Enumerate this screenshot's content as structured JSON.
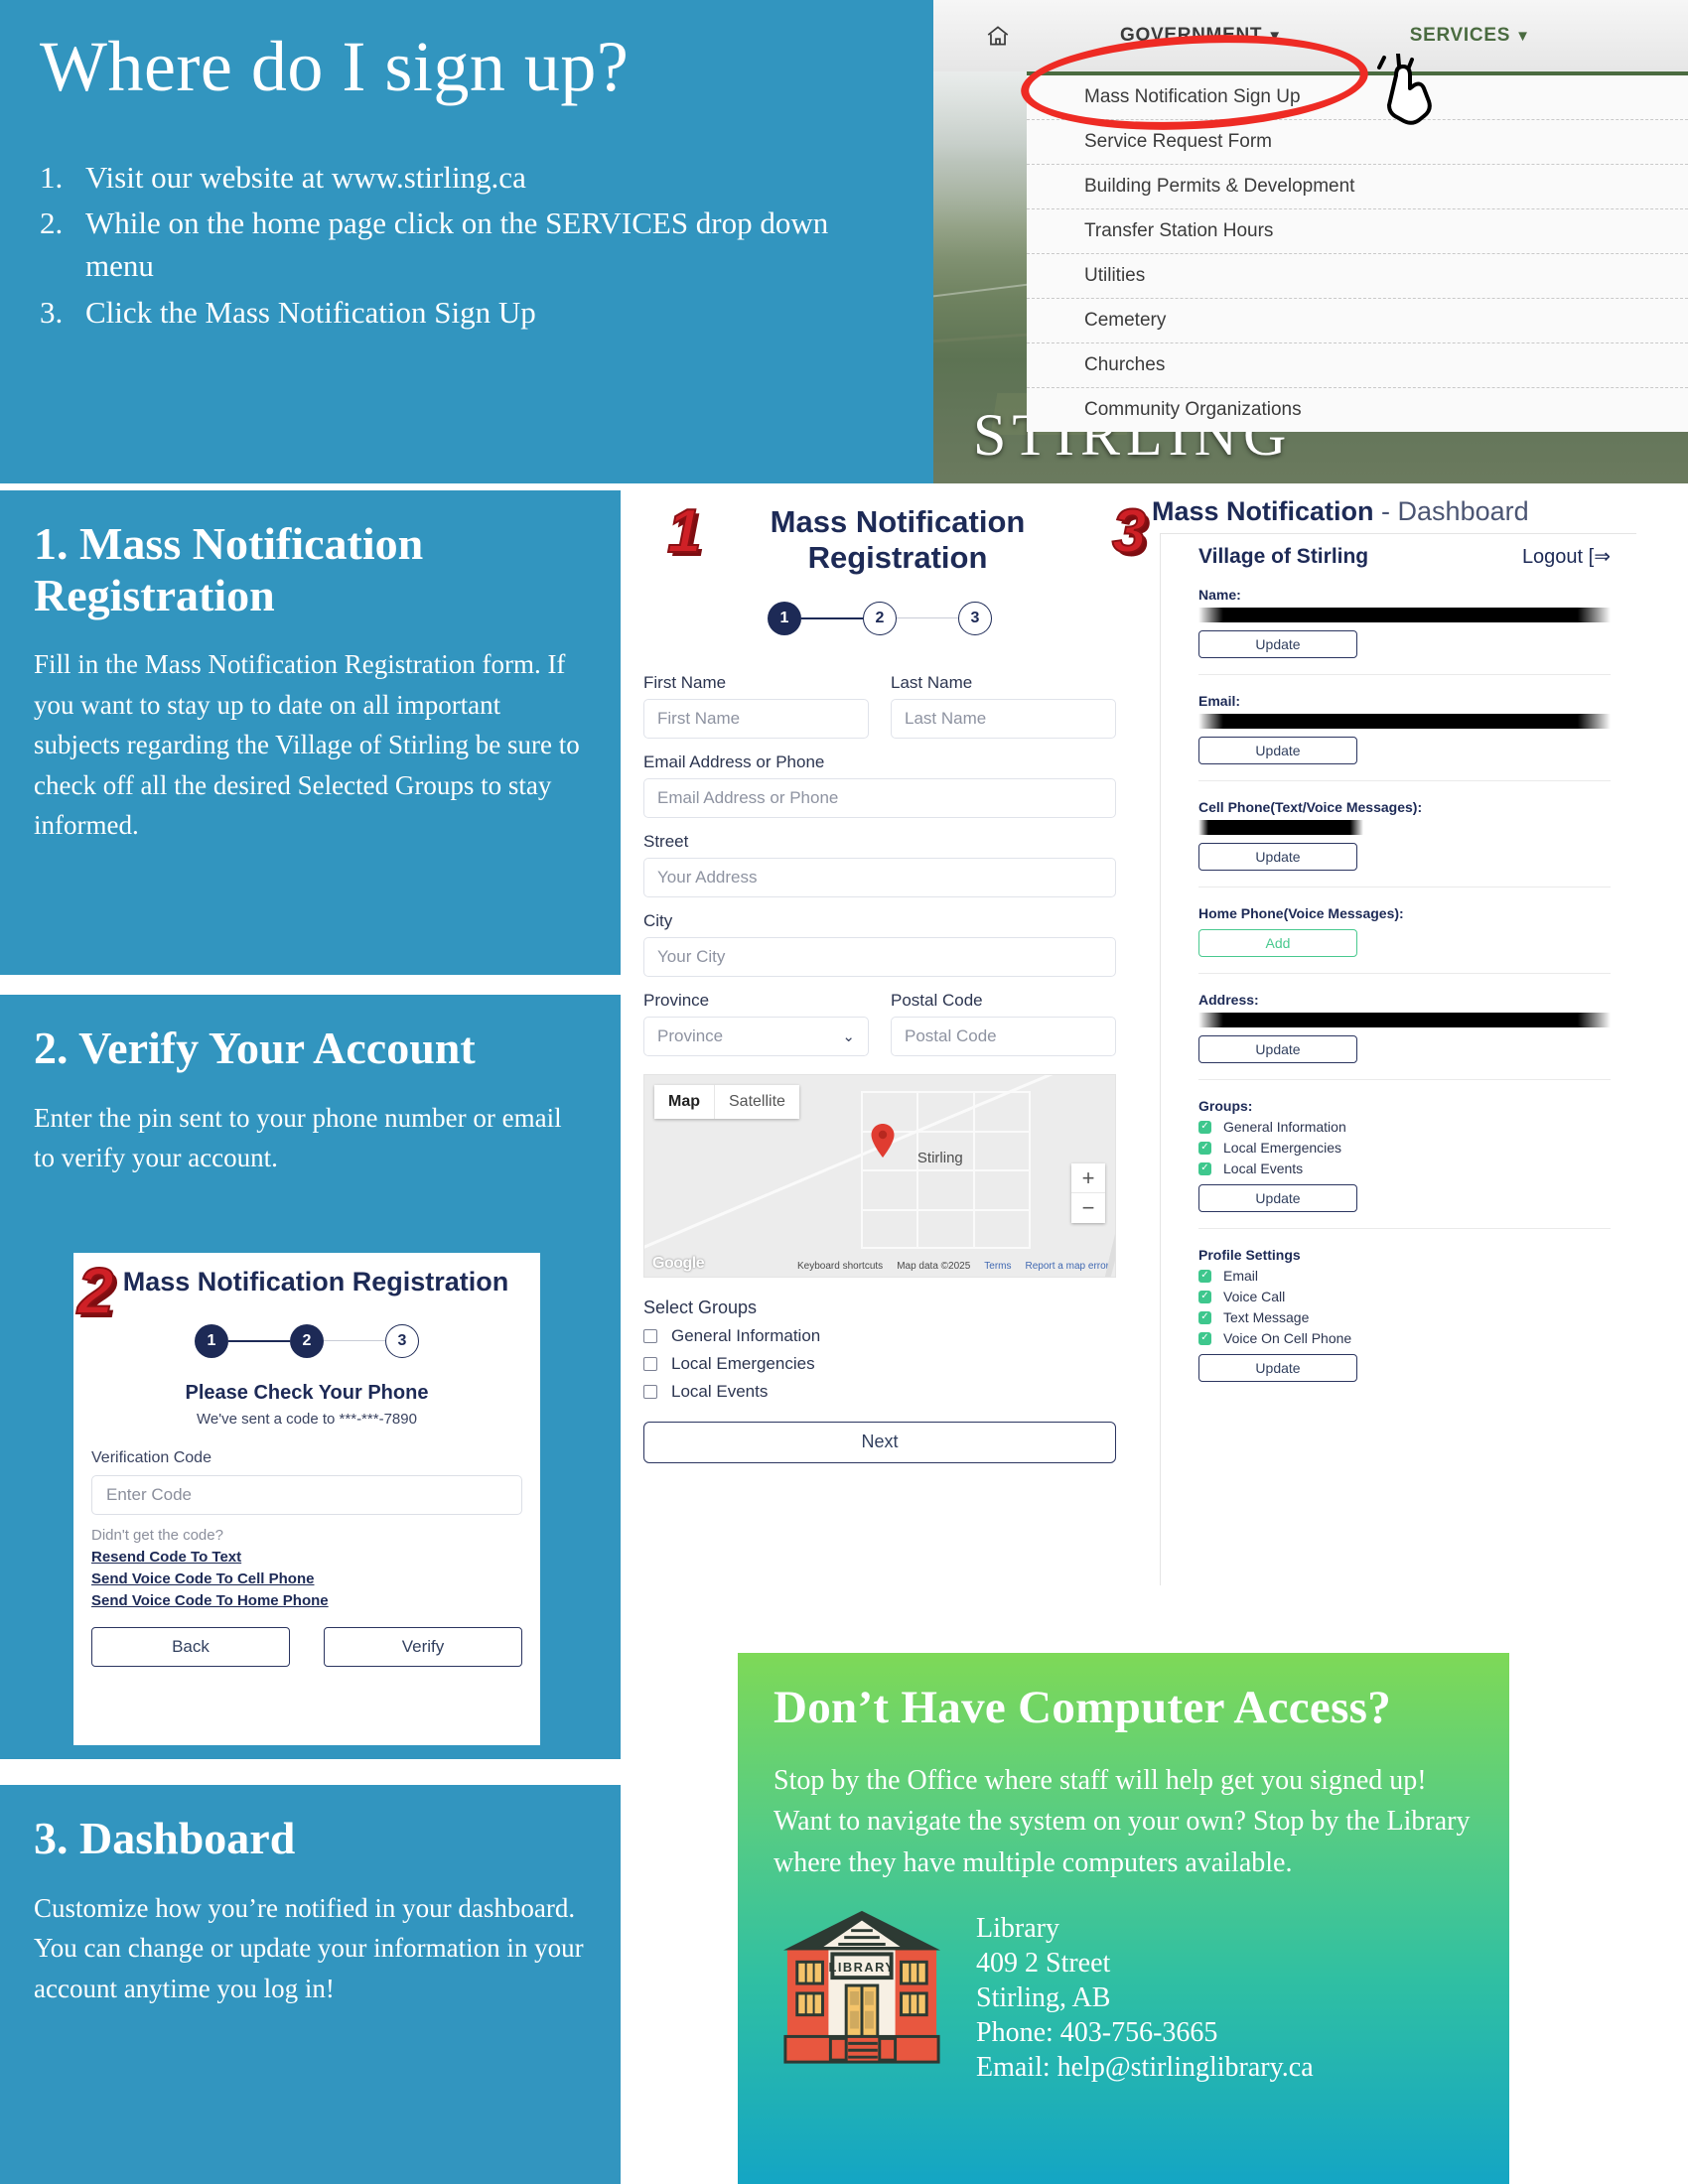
{
  "hero": {
    "title": "Where do I sign up?",
    "steps": [
      {
        "num": "1.",
        "text": "Visit our website at www.stirling.ca"
      },
      {
        "num": "2.",
        "text": "While on the home page click on the SERVICES drop down menu"
      },
      {
        "num": "3.",
        "text": "Click the Mass Notification Sign Up"
      }
    ]
  },
  "site": {
    "nav": {
      "home_icon": "home-icon",
      "government": "GOVERNMENT",
      "services": "SERVICES",
      "caret": "▼"
    },
    "banner_word": "STIRLING",
    "dropdown_items": [
      "Mass Notification Sign Up",
      "Service Request Form",
      "Building Permits & Development",
      "Transfer Station Hours",
      "Utilities",
      "Cemetery",
      "Churches",
      "Community Organizations"
    ]
  },
  "panels": [
    {
      "heading": "1. Mass Notification Registration",
      "body": "Fill in the Mass Notification Registration form. If you want to stay up to date on all important subjects regarding the Village of Stirling be sure to check off all the desired Selected Groups to stay informed."
    },
    {
      "heading": "2. Verify Your Account",
      "body": "Enter the pin sent to your phone number or email to verify your account."
    },
    {
      "heading": "3. Dashboard",
      "body": "Customize how you’re notified in your dashboard. You can change or update your information in your account anytime you log in!"
    }
  ],
  "callout_numbers": {
    "one": "1",
    "two": "2",
    "three": "3"
  },
  "registration": {
    "title": "Mass Notification Registration",
    "steps": [
      "1",
      "2",
      "3"
    ],
    "active_step": "1",
    "fields": [
      {
        "label": "First Name",
        "placeholder": "First Name"
      },
      {
        "label": "Last Name",
        "placeholder": "Last Name"
      },
      {
        "label": "Email Address or Phone",
        "placeholder": "Email Address or Phone"
      },
      {
        "label": "Street",
        "placeholder": "Your Address"
      },
      {
        "label": "City",
        "placeholder": "Your City"
      },
      {
        "label": "Province",
        "placeholder": "Province"
      },
      {
        "label": "Postal Code",
        "placeholder": "Postal Code"
      }
    ],
    "map": {
      "tab_map": "Map",
      "tab_satellite": "Satellite",
      "place_label": "Stirling",
      "zoom_in": "+",
      "zoom_out": "−",
      "attribution": "Google",
      "credits": [
        "Keyboard shortcuts",
        "Map data ©2025",
        "Terms",
        "Report a map error"
      ]
    },
    "select_groups_label": "Select Groups",
    "groups": [
      "General Information",
      "Local Emergencies",
      "Local Events"
    ],
    "next_label": "Next"
  },
  "verify": {
    "title": "Mass Notification Registration",
    "steps": [
      "1",
      "2",
      "3"
    ],
    "active_step": "2",
    "subtitle": "Please Check Your Phone",
    "sent_to": "We've sent a code to ***-***-7890",
    "code_label": "Verification Code",
    "code_placeholder": "Enter Code",
    "hint": "Didn't get the code?",
    "links": [
      "Resend Code To Text",
      "Send Voice Code To Cell Phone",
      "Send Voice Code To Home Phone"
    ],
    "back_label": "Back",
    "verify_label": "Verify"
  },
  "dashboard": {
    "title_bold": "Mass Notification",
    "title_light": "- Dashboard",
    "org": "Village of Stirling",
    "logout": "Logout",
    "sections": [
      {
        "label": "Name:",
        "value_redacted": true,
        "button": "Update"
      },
      {
        "label": "Email:",
        "value_redacted": true,
        "button": "Update"
      },
      {
        "label": "Cell Phone(Text/Voice Messages):",
        "value_redacted": true,
        "button": "Update"
      },
      {
        "label": "Home Phone(Voice Messages):",
        "value_redacted": false,
        "button": "Add"
      },
      {
        "label": "Address:",
        "value_redacted": true,
        "button": "Update"
      }
    ],
    "groups_label": "Groups:",
    "groups": [
      "General Information",
      "Local Emergencies",
      "Local Events"
    ],
    "groups_button": "Update",
    "profile_label": "Profile Settings",
    "profile_options": [
      "Email",
      "Voice Call",
      "Text Message",
      "Voice On Cell Phone"
    ],
    "profile_button": "Update"
  },
  "library": {
    "title": "Don’t Have Computer Access?",
    "body": "Stop by the Office where staff will help get you signed up! Want to navigate the system on your own? Stop by the Library where they have multiple computers available.",
    "sign_text": "LIBRARY",
    "address_lines": [
      "Library",
      "409 2 Street",
      "Stirling, AB",
      "Phone: 403-756-3665",
      "Email: help@stirlinglibrary.ca"
    ]
  },
  "colors": {
    "brand_blue": "#3295bf",
    "navy": "#1d2a56",
    "red_accent": "#cf2026",
    "green_start": "#7ed957",
    "teal_end": "#14a5c4",
    "checkbox_green": "#3ec78d"
  }
}
